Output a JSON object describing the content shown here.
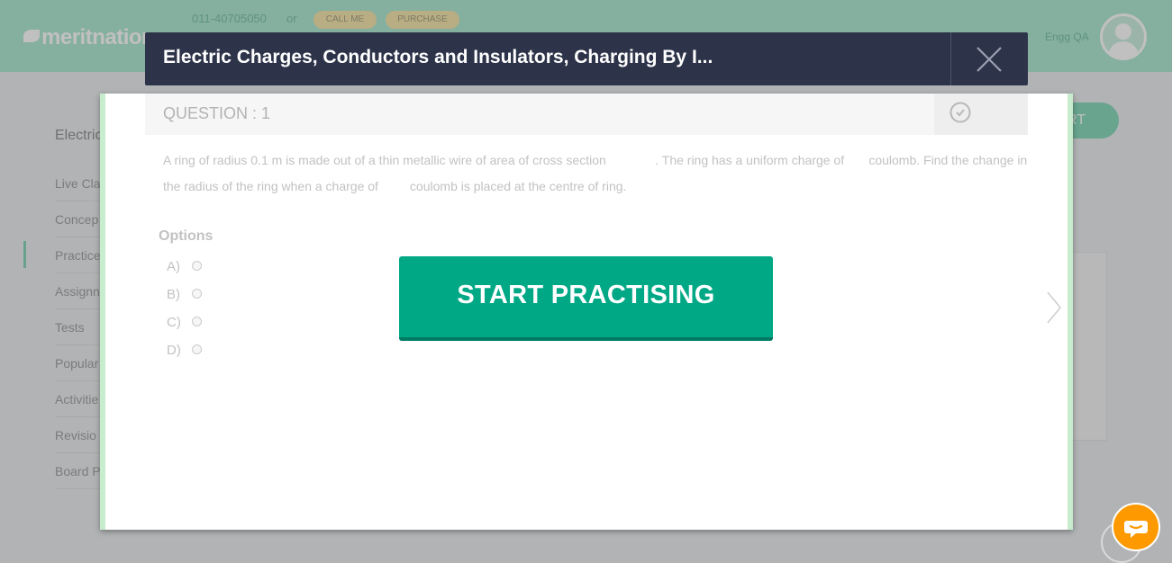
{
  "header": {
    "logo_text": "meritnation",
    "phone": "011-40705050",
    "or_text": "or",
    "call_me_label": "CALL ME",
    "purchase_label": "PURCHASE",
    "username": "Engg QA"
  },
  "sidebar": {
    "chapter_title": "Electric",
    "items": [
      {
        "label": "Live Cla"
      },
      {
        "label": "Concep"
      },
      {
        "label": "Practice"
      },
      {
        "label": "Assignn"
      },
      {
        "label": "Tests"
      },
      {
        "label": "Popular"
      },
      {
        "label": "Activitie"
      },
      {
        "label": "Revisio"
      },
      {
        "label": "Board P"
      }
    ]
  },
  "background_start_label": "RT",
  "dialog": {
    "title": "Electric Charges, Conductors and Insulators, Charging By I...",
    "question_label": "QUESTION : 1",
    "question_text": "A ring of radius 0.1 m is made out of a thin metallic wire of area of cross section              . The ring has a uniform charge of       coulomb. Find the change in the radius of the ring when a charge of         coulomb is placed at the centre of ring.",
    "options_label": "Options",
    "options": [
      {
        "label": "A)"
      },
      {
        "label": "B)"
      },
      {
        "label": "C)"
      },
      {
        "label": "D)"
      }
    ],
    "start_button_label": "START PRACTISING"
  },
  "colors": {
    "accent_green": "#00a886",
    "header_bg": "#2d3349",
    "chat_orange": "#ff9900"
  },
  "icons": {
    "close": "close-icon",
    "timer": "clock-icon",
    "chat": "chat-icon",
    "next": "chevron-right-icon"
  }
}
